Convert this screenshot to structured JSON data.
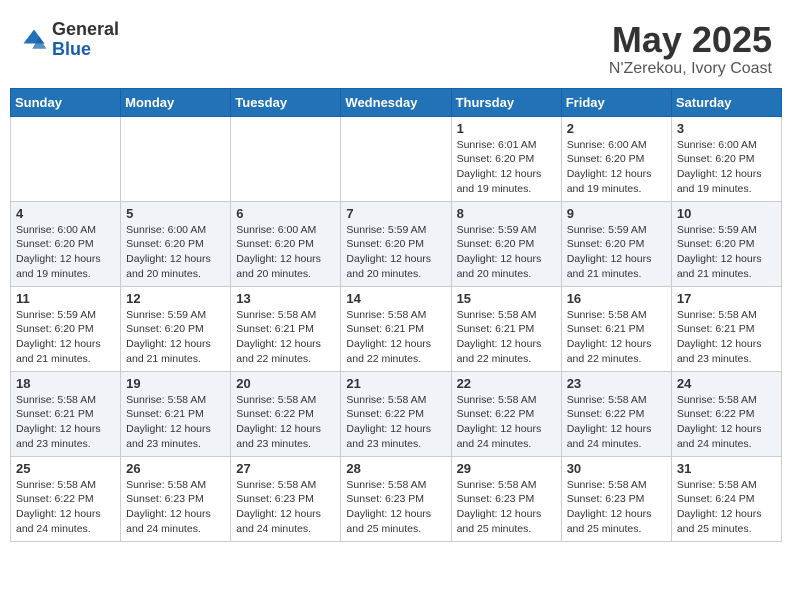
{
  "header": {
    "logo_general": "General",
    "logo_blue": "Blue",
    "month_title": "May 2025",
    "location": "N'Zerekou, Ivory Coast"
  },
  "days_of_week": [
    "Sunday",
    "Monday",
    "Tuesday",
    "Wednesday",
    "Thursday",
    "Friday",
    "Saturday"
  ],
  "weeks": [
    [
      {
        "day": "",
        "info": ""
      },
      {
        "day": "",
        "info": ""
      },
      {
        "day": "",
        "info": ""
      },
      {
        "day": "",
        "info": ""
      },
      {
        "day": "1",
        "info": "Sunrise: 6:01 AM\nSunset: 6:20 PM\nDaylight: 12 hours\nand 19 minutes."
      },
      {
        "day": "2",
        "info": "Sunrise: 6:00 AM\nSunset: 6:20 PM\nDaylight: 12 hours\nand 19 minutes."
      },
      {
        "day": "3",
        "info": "Sunrise: 6:00 AM\nSunset: 6:20 PM\nDaylight: 12 hours\nand 19 minutes."
      }
    ],
    [
      {
        "day": "4",
        "info": "Sunrise: 6:00 AM\nSunset: 6:20 PM\nDaylight: 12 hours\nand 19 minutes."
      },
      {
        "day": "5",
        "info": "Sunrise: 6:00 AM\nSunset: 6:20 PM\nDaylight: 12 hours\nand 20 minutes."
      },
      {
        "day": "6",
        "info": "Sunrise: 6:00 AM\nSunset: 6:20 PM\nDaylight: 12 hours\nand 20 minutes."
      },
      {
        "day": "7",
        "info": "Sunrise: 5:59 AM\nSunset: 6:20 PM\nDaylight: 12 hours\nand 20 minutes."
      },
      {
        "day": "8",
        "info": "Sunrise: 5:59 AM\nSunset: 6:20 PM\nDaylight: 12 hours\nand 20 minutes."
      },
      {
        "day": "9",
        "info": "Sunrise: 5:59 AM\nSunset: 6:20 PM\nDaylight: 12 hours\nand 21 minutes."
      },
      {
        "day": "10",
        "info": "Sunrise: 5:59 AM\nSunset: 6:20 PM\nDaylight: 12 hours\nand 21 minutes."
      }
    ],
    [
      {
        "day": "11",
        "info": "Sunrise: 5:59 AM\nSunset: 6:20 PM\nDaylight: 12 hours\nand 21 minutes."
      },
      {
        "day": "12",
        "info": "Sunrise: 5:59 AM\nSunset: 6:20 PM\nDaylight: 12 hours\nand 21 minutes."
      },
      {
        "day": "13",
        "info": "Sunrise: 5:58 AM\nSunset: 6:21 PM\nDaylight: 12 hours\nand 22 minutes."
      },
      {
        "day": "14",
        "info": "Sunrise: 5:58 AM\nSunset: 6:21 PM\nDaylight: 12 hours\nand 22 minutes."
      },
      {
        "day": "15",
        "info": "Sunrise: 5:58 AM\nSunset: 6:21 PM\nDaylight: 12 hours\nand 22 minutes."
      },
      {
        "day": "16",
        "info": "Sunrise: 5:58 AM\nSunset: 6:21 PM\nDaylight: 12 hours\nand 22 minutes."
      },
      {
        "day": "17",
        "info": "Sunrise: 5:58 AM\nSunset: 6:21 PM\nDaylight: 12 hours\nand 23 minutes."
      }
    ],
    [
      {
        "day": "18",
        "info": "Sunrise: 5:58 AM\nSunset: 6:21 PM\nDaylight: 12 hours\nand 23 minutes."
      },
      {
        "day": "19",
        "info": "Sunrise: 5:58 AM\nSunset: 6:21 PM\nDaylight: 12 hours\nand 23 minutes."
      },
      {
        "day": "20",
        "info": "Sunrise: 5:58 AM\nSunset: 6:22 PM\nDaylight: 12 hours\nand 23 minutes."
      },
      {
        "day": "21",
        "info": "Sunrise: 5:58 AM\nSunset: 6:22 PM\nDaylight: 12 hours\nand 23 minutes."
      },
      {
        "day": "22",
        "info": "Sunrise: 5:58 AM\nSunset: 6:22 PM\nDaylight: 12 hours\nand 24 minutes."
      },
      {
        "day": "23",
        "info": "Sunrise: 5:58 AM\nSunset: 6:22 PM\nDaylight: 12 hours\nand 24 minutes."
      },
      {
        "day": "24",
        "info": "Sunrise: 5:58 AM\nSunset: 6:22 PM\nDaylight: 12 hours\nand 24 minutes."
      }
    ],
    [
      {
        "day": "25",
        "info": "Sunrise: 5:58 AM\nSunset: 6:22 PM\nDaylight: 12 hours\nand 24 minutes."
      },
      {
        "day": "26",
        "info": "Sunrise: 5:58 AM\nSunset: 6:23 PM\nDaylight: 12 hours\nand 24 minutes."
      },
      {
        "day": "27",
        "info": "Sunrise: 5:58 AM\nSunset: 6:23 PM\nDaylight: 12 hours\nand 24 minutes."
      },
      {
        "day": "28",
        "info": "Sunrise: 5:58 AM\nSunset: 6:23 PM\nDaylight: 12 hours\nand 25 minutes."
      },
      {
        "day": "29",
        "info": "Sunrise: 5:58 AM\nSunset: 6:23 PM\nDaylight: 12 hours\nand 25 minutes."
      },
      {
        "day": "30",
        "info": "Sunrise: 5:58 AM\nSunset: 6:23 PM\nDaylight: 12 hours\nand 25 minutes."
      },
      {
        "day": "31",
        "info": "Sunrise: 5:58 AM\nSunset: 6:24 PM\nDaylight: 12 hours\nand 25 minutes."
      }
    ]
  ]
}
